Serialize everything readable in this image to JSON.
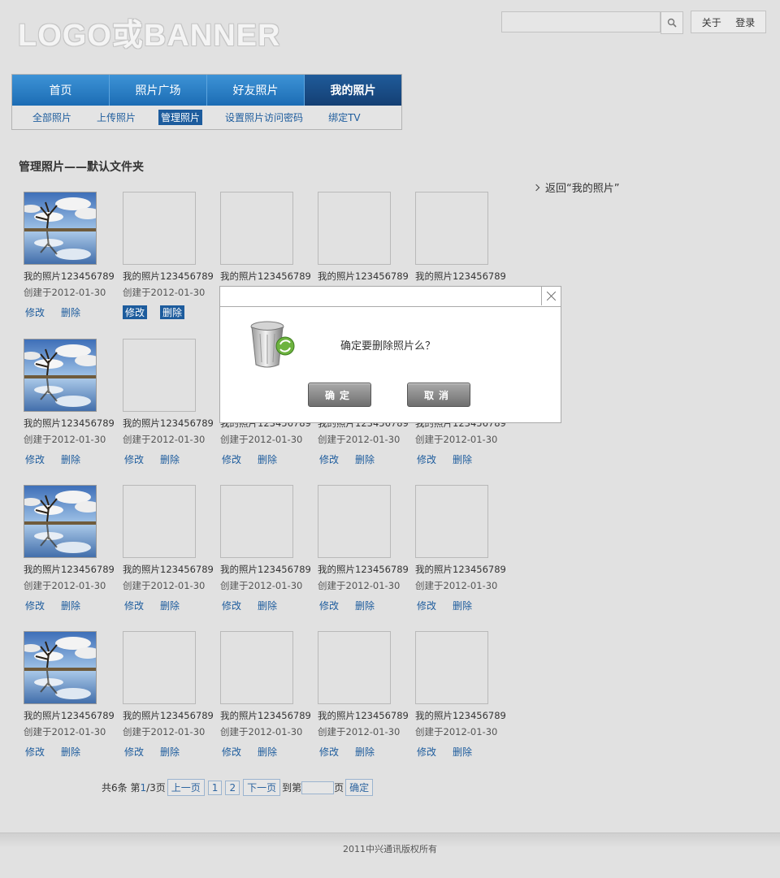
{
  "header": {
    "logo": "LOGO或BANNER",
    "links": [
      "关于",
      "登录"
    ]
  },
  "nav": {
    "tabs": [
      "首页",
      "照片广场",
      "好友照片",
      "我的照片"
    ],
    "active_tab": "我的照片",
    "sub_items": [
      "全部照片",
      "上传照片",
      "管理照片",
      "设置照片访问密码",
      "绑定TV"
    ],
    "active_sub": "管理照片"
  },
  "page": {
    "title": "管理照片——默认文件夹",
    "back_link": "返回“我的照片”"
  },
  "photos": {
    "name": "我的照片123456789",
    "date": "创建于2012-01-30",
    "edit": "修改",
    "delete": "删除"
  },
  "pager": {
    "total_prefix": "共6条 第",
    "current": "1",
    "total_suffix": "/3页",
    "prev": "上一页",
    "pages": [
      "1",
      "2"
    ],
    "next": "下一页",
    "goto_prefix": "到第",
    "goto_suffix": "页",
    "confirm": "确定"
  },
  "footer": {
    "copyright": "2011中兴通讯版权所有"
  },
  "dialog": {
    "message": "确定要删除照片么？",
    "ok": "确定",
    "cancel": "取消"
  },
  "colors": {
    "accent": "#1d5c9d",
    "nav_blue": "#2a7cc4",
    "nav_active": "#1a4e86"
  }
}
